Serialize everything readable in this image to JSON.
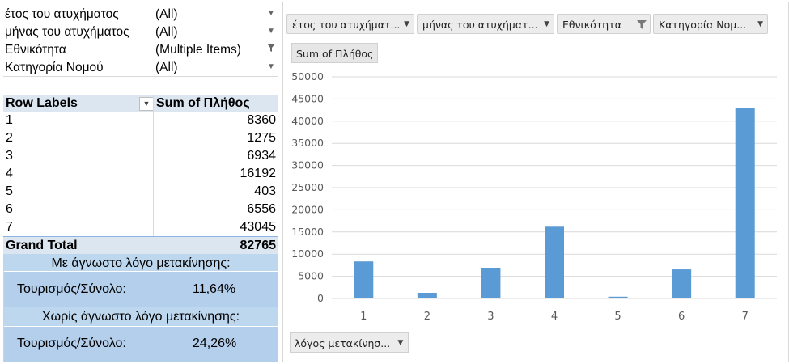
{
  "filters": [
    {
      "name": "έτος του ατυχήματος",
      "value": "(All)",
      "icon": "dropdown-arrow-icon"
    },
    {
      "name": "μήνας του ατυχήματος",
      "value": "(All)",
      "icon": "dropdown-arrow-icon"
    },
    {
      "name": "Εθνικότητα",
      "value": "(Multiple Items)",
      "icon": "filter-icon"
    },
    {
      "name": "Κατηγορία Νομού",
      "value": "(All)",
      "icon": "dropdown-arrow-icon"
    }
  ],
  "pivot": {
    "row_header": "Row Labels",
    "value_header": "Sum of Πλήθος",
    "rows": [
      {
        "label": "1",
        "value": "8360"
      },
      {
        "label": "2",
        "value": "1275"
      },
      {
        "label": "3",
        "value": "6934"
      },
      {
        "label": "4",
        "value": "16192"
      },
      {
        "label": "5",
        "value": "403"
      },
      {
        "label": "6",
        "value": "6556"
      },
      {
        "label": "7",
        "value": "43045"
      }
    ],
    "grand_total_label": "Grand Total",
    "grand_total_value": "82765"
  },
  "summary": {
    "box1_title": "Με άγνωστο λόγο μετακίνησης:",
    "box1_label": "Τουρισμός/Σύνολο:",
    "box1_value": "11,64%",
    "box2_title": "Χωρίς άγνωστο λόγο μετακίνησης:",
    "box2_label": "Τουρισμός/Σύνολο:",
    "box2_value": "24,26%"
  },
  "chart_buttons": [
    "έτος του ατυχήματ...",
    "μήνας του ατυχήματ...",
    "Εθνικότητα",
    "Κατηγορία Νομ..."
  ],
  "value_button": "Sum of Πλήθος",
  "axis_button": "λόγος μετακίνησ...",
  "colors": {
    "bar": "#5b9bd5",
    "pivot_header": "#dce6f1",
    "summary_box": "#bdd7ee"
  },
  "chart_data": {
    "type": "bar",
    "categories": [
      "1",
      "2",
      "3",
      "4",
      "5",
      "6",
      "7"
    ],
    "values": [
      8360,
      1275,
      6934,
      16192,
      403,
      6556,
      43045
    ],
    "ylim": [
      0,
      50000
    ],
    "yticks": [
      0,
      5000,
      10000,
      15000,
      20000,
      25000,
      30000,
      35000,
      40000,
      45000,
      50000
    ],
    "grid": true,
    "legend": "none"
  }
}
